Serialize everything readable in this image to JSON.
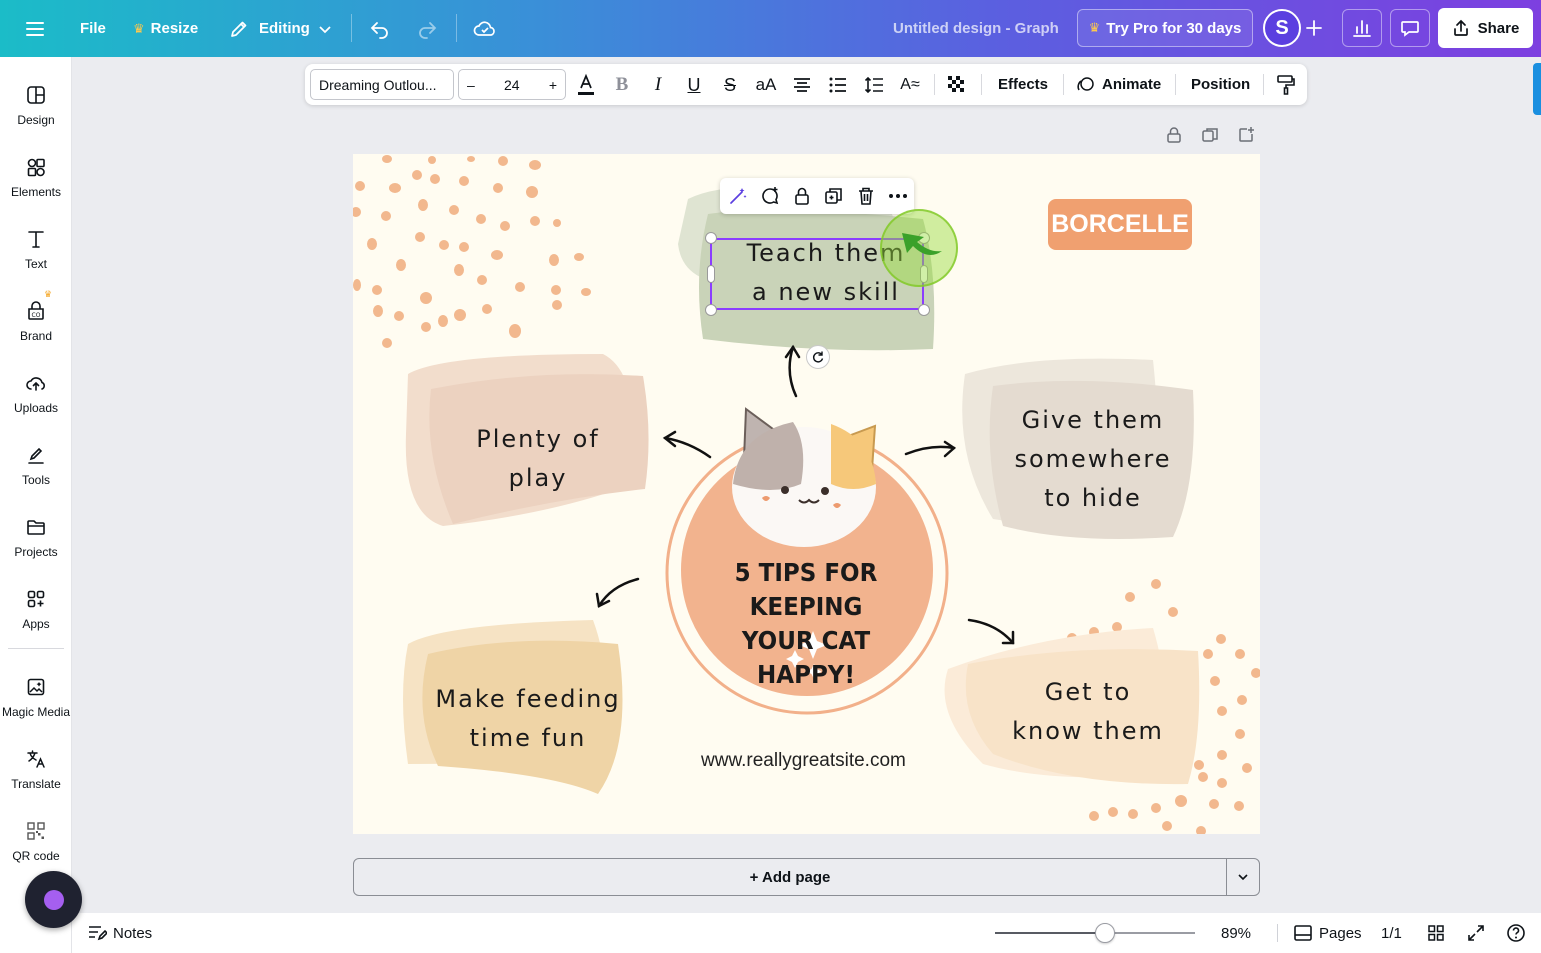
{
  "topbar": {
    "file_label": "File",
    "resize_label": "Resize",
    "editing_label": "Editing",
    "design_title": "Untitled design - Graph",
    "try_pro_label": "Try Pro for 30 days",
    "avatar_initial": "S",
    "share_label": "Share",
    "colors": {
      "gradient_start": "#1bbcc8",
      "gradient_end": "#7d3fe0"
    }
  },
  "sidebar": {
    "items": [
      {
        "label": "Design",
        "icon": "design-icon"
      },
      {
        "label": "Elements",
        "icon": "elements-icon"
      },
      {
        "label": "Text",
        "icon": "text-icon"
      },
      {
        "label": "Brand",
        "icon": "brand-icon"
      },
      {
        "label": "Uploads",
        "icon": "uploads-icon"
      },
      {
        "label": "Tools",
        "icon": "tools-icon"
      },
      {
        "label": "Projects",
        "icon": "projects-icon"
      },
      {
        "label": "Apps",
        "icon": "apps-icon"
      },
      {
        "label": "Magic Media",
        "icon": "magic-media-icon"
      },
      {
        "label": "Translate",
        "icon": "translate-icon"
      },
      {
        "label": "QR code",
        "icon": "qr-code-icon"
      }
    ]
  },
  "text_toolbar": {
    "font_name": "Dreaming Outlou...",
    "font_size": "24",
    "minus": "–",
    "plus": "+",
    "effects_label": "Effects",
    "animate_label": "Animate",
    "position_label": "Position"
  },
  "design": {
    "brand": "BORCELLE",
    "center_title_line1": "5 TIPS FOR KEEPING",
    "center_title_line2": "YOUR CAT HAPPY!",
    "tips": {
      "top_line1": "Teach them",
      "top_line2": "a new skill",
      "left_top": "Plenty of play",
      "right_top_line1": "Give them",
      "right_top_line2": "somewhere",
      "right_top_line3": "to hide",
      "left_bottom_line1": "Make feeding",
      "left_bottom_line2": "time fun",
      "right_bottom_line1": "Get to",
      "right_bottom_line2": "know them"
    },
    "url": "www.reallygreatsite.com",
    "colors": {
      "background": "#fffcf1",
      "accent": "#f0a070",
      "sage": "#c9d3b8"
    }
  },
  "add_page_label": "+ Add page",
  "bottombar": {
    "notes_label": "Notes",
    "zoom_value": "89%",
    "zoom_fraction": 0.55,
    "pages_label": "Pages",
    "page_count": "1/1"
  }
}
